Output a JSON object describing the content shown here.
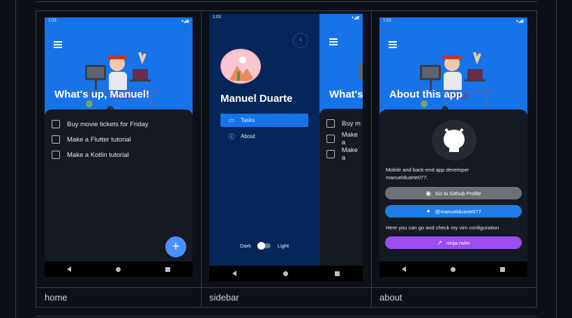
{
  "columns": [
    {
      "label": "home"
    },
    {
      "label": "sidebar"
    },
    {
      "label": "about"
    }
  ],
  "status": {
    "time": "1:03",
    "icons": "▾◢▮"
  },
  "home": {
    "title": "What's up, Manuel!",
    "tasks": [
      "Buy movie tickets for Friday",
      "Make a Flutter tutorial",
      "Make a Kotlin tutorial"
    ],
    "fab_label": "+"
  },
  "sidebar": {
    "name": "Manuel Duarte",
    "items": [
      {
        "label": "Tasks",
        "icon": "inbox-icon",
        "active": true
      },
      {
        "label": "About",
        "icon": "info-icon",
        "active": false
      }
    ],
    "toggle": {
      "left": "Dark",
      "right": "Light"
    },
    "peek": {
      "title": "What's",
      "tasks": [
        "Buy m",
        "Make a",
        "Make a"
      ]
    }
  },
  "about": {
    "title": "About this app",
    "bio": "Mobile and back-end app developer manuelduarte077.",
    "github_btn": "Go to Github Profile",
    "twitter_btn": "@manuelduarte077",
    "vim_text": "Here you can go and check my vim configuration",
    "nvim_btn": "ninja.nvim",
    "colors": {
      "github": "#6e7075",
      "twitter": "#1d7ce8",
      "nvim": "#9b4df0"
    }
  }
}
